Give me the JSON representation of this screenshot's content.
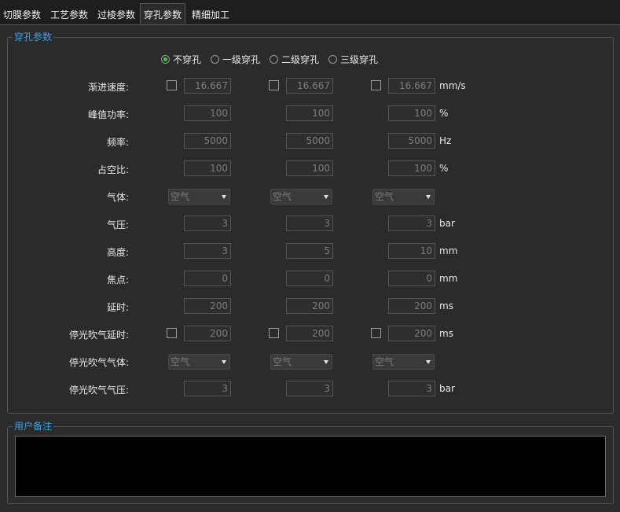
{
  "tabs": [
    {
      "label": "切膜参数",
      "active": false
    },
    {
      "label": "工艺参数",
      "active": false
    },
    {
      "label": "过棱参数",
      "active": false
    },
    {
      "label": "穿孔参数",
      "active": true
    },
    {
      "label": "精细加工",
      "active": false
    }
  ],
  "pierce_group": {
    "title": "穿孔参数",
    "modes": [
      {
        "label": "不穿孔",
        "checked": true
      },
      {
        "label": "一级穿孔",
        "checked": false
      },
      {
        "label": "二级穿孔",
        "checked": false
      },
      {
        "label": "三级穿孔",
        "checked": false
      }
    ],
    "rows": [
      {
        "label": "渐进速度:",
        "type": "check-input",
        "values": [
          "16.667",
          "16.667",
          "16.667"
        ],
        "unit": "mm/s"
      },
      {
        "label": "峰值功率:",
        "type": "input",
        "values": [
          "100",
          "100",
          "100"
        ],
        "unit": "%"
      },
      {
        "label": "频率:",
        "type": "input",
        "values": [
          "5000",
          "5000",
          "5000"
        ],
        "unit": "Hz"
      },
      {
        "label": "占空比:",
        "type": "input",
        "values": [
          "100",
          "100",
          "100"
        ],
        "unit": "%"
      },
      {
        "label": "气体:",
        "type": "combo",
        "values": [
          "空气",
          "空气",
          "空气"
        ],
        "unit": ""
      },
      {
        "label": "气压:",
        "type": "input",
        "values": [
          "3",
          "3",
          "3"
        ],
        "unit": "bar"
      },
      {
        "label": "高度:",
        "type": "input",
        "values": [
          "3",
          "5",
          "10"
        ],
        "unit": "mm"
      },
      {
        "label": "焦点:",
        "type": "input",
        "values": [
          "0",
          "0",
          "0"
        ],
        "unit": "mm"
      },
      {
        "label": "延时:",
        "type": "input",
        "values": [
          "200",
          "200",
          "200"
        ],
        "unit": "ms"
      },
      {
        "label": "停光吹气延时:",
        "type": "check-input",
        "values": [
          "200",
          "200",
          "200"
        ],
        "unit": "ms"
      },
      {
        "label": "停光吹气气体:",
        "type": "combo",
        "values": [
          "空气",
          "空气",
          "空气"
        ],
        "unit": ""
      },
      {
        "label": "停光吹气气压:",
        "type": "input",
        "values": [
          "3",
          "3",
          "3"
        ],
        "unit": "bar"
      }
    ]
  },
  "notes_group": {
    "title": "用户备注",
    "text": ""
  },
  "colors": {
    "accent": "#3aa0e6",
    "radio_checked": "#33d633",
    "background": "#2b2b2b"
  }
}
